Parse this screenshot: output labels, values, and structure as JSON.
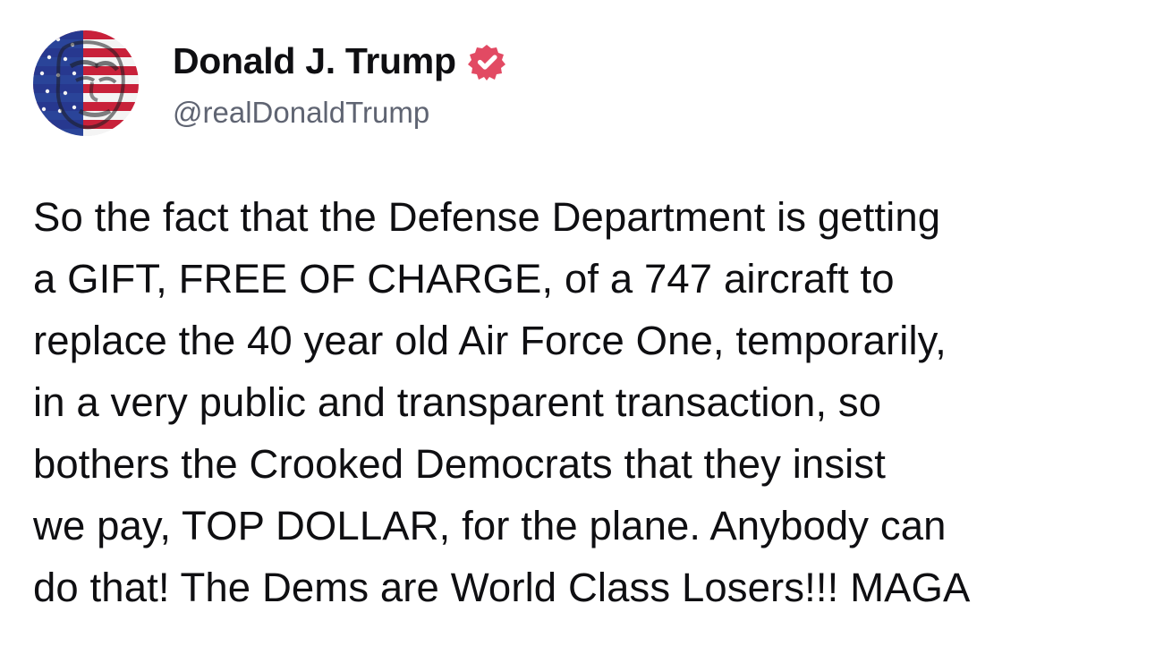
{
  "post": {
    "author": {
      "display_name": "Donald J. Trump",
      "handle": "@realDonaldTrump",
      "verified": true,
      "verified_icon": "verified-badge-icon",
      "verified_color": "#e24a63"
    },
    "avatar": {
      "icon": "flag-portrait-avatar",
      "colors": {
        "red": "#c8213a",
        "blue": "#1f3a93",
        "white": "#f4f4f4",
        "dark": "#1b1b1f"
      }
    },
    "text": "So the fact that the Defense Department is getting\na GIFT, FREE OF CHARGE, of a 747 aircraft to\nreplace the 40 year old Air Force One, temporarily,\nin a very public and transparent transaction, so\nbothers the Crooked Democrats that they insist\nwe pay, TOP DOLLAR, for the plane. Anybody can\ndo that! The Dems are World Class Losers!!! MAGA"
  }
}
